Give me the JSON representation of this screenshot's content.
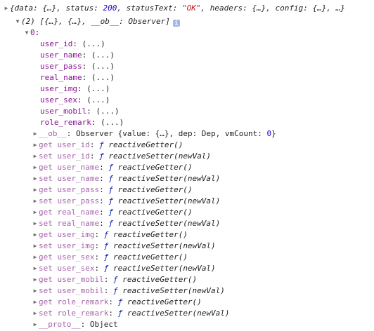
{
  "console": {
    "response_summary": "{data: {…}, status: 200, statusText: \"OK\", headers: {…}, config: {…}, …}",
    "response_summary_parts": {
      "pre_status": "{data: {…}, status: ",
      "status_value": "200",
      "mid": ", statusText: ",
      "status_text": "\"OK\"",
      "post": ", headers: {…}, config: {…}, …}"
    },
    "array_summary": "(2) [{…}, {…}, __ob__: Observer]",
    "info_badge": "i",
    "index_label": "0",
    "fields": [
      {
        "key": "user_id",
        "value": "(...)"
      },
      {
        "key": "user_name",
        "value": "(...)"
      },
      {
        "key": "user_pass",
        "value": "(...)"
      },
      {
        "key": "real_name",
        "value": "(...)"
      },
      {
        "key": "user_img",
        "value": "(...)"
      },
      {
        "key": "user_sex",
        "value": "(...)"
      },
      {
        "key": "user_mobil",
        "value": "(...)"
      },
      {
        "key": "role_remark",
        "value": "(...)"
      }
    ],
    "ob_row": {
      "key": "__ob__",
      "prefix": "Observer {value: {…}, dep: Dep, vmCount: ",
      "count": "0",
      "suffix": "}"
    },
    "accessors": [
      {
        "label": "get user_id",
        "func": "reactiveGetter()"
      },
      {
        "label": "set user_id",
        "func": "reactiveSetter(newVal)"
      },
      {
        "label": "get user_name",
        "func": "reactiveGetter()"
      },
      {
        "label": "set user_name",
        "func": "reactiveSetter(newVal)"
      },
      {
        "label": "get user_pass",
        "func": "reactiveGetter()"
      },
      {
        "label": "set user_pass",
        "func": "reactiveSetter(newVal)"
      },
      {
        "label": "get real_name",
        "func": "reactiveGetter()"
      },
      {
        "label": "set real_name",
        "func": "reactiveSetter(newVal)"
      },
      {
        "label": "get user_img",
        "func": "reactiveGetter()"
      },
      {
        "label": "set user_img",
        "func": "reactiveSetter(newVal)"
      },
      {
        "label": "get user_sex",
        "func": "reactiveGetter()"
      },
      {
        "label": "set user_sex",
        "func": "reactiveSetter(newVal)"
      },
      {
        "label": "get user_mobil",
        "func": "reactiveGetter()"
      },
      {
        "label": "set user_mobil",
        "func": "reactiveSetter(newVal)"
      },
      {
        "label": "get role_remark",
        "func": "reactiveGetter()"
      },
      {
        "label": "set role_remark",
        "func": "reactiveSetter(newVal)"
      }
    ],
    "func_symbol": "ƒ",
    "proto_row": {
      "key": "__proto__",
      "value": "Object"
    }
  }
}
